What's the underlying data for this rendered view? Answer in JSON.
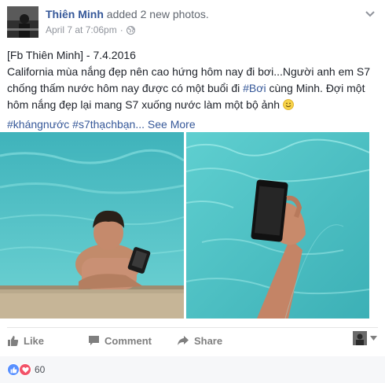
{
  "post": {
    "author_name": "Thiên Minh",
    "action_text": "added 2 new photos.",
    "timestamp": "April 7 at 7:06pm",
    "separator": "·",
    "privacy_icon": "globe-icon",
    "text": {
      "line1": "[Fb Thiên Minh] - 7.4.2016",
      "body_before_hashtag": "California mùa nắng đẹp nên cao hứng hôm nay đi bơi...Người anh em S7 chống thấm nước hôm nay được có một buổi đi ",
      "hashtag_inline": "#Bơi",
      "body_after_hashtag": " cùng Minh. Đợi một hôm nắng đẹp lại mang S7 xuống nước làm một bộ ảnh ",
      "hashtags": "#khángnước #s7thạchbạn...",
      "see_more": "See More"
    },
    "photos": [
      {
        "name": "man-in-pool-holding-phone"
      },
      {
        "name": "hand-holding-phone-underwater"
      }
    ]
  },
  "actions": {
    "like": "Like",
    "comment": "Comment",
    "share": "Share"
  },
  "reactions": {
    "count": "60",
    "types": [
      "like",
      "love"
    ]
  },
  "colors": {
    "link": "#365899",
    "meta": "#90949c",
    "water": "#4fc3c9",
    "like_blue": "#5890ff",
    "love_red": "#f25268"
  }
}
